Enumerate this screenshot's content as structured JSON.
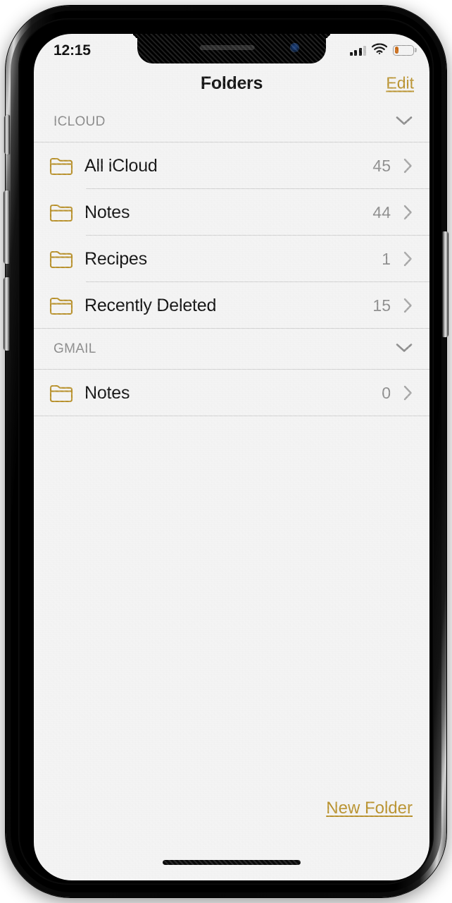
{
  "status_bar": {
    "time": "12:15",
    "cellular_icon": "cellular-bars-icon",
    "wifi_icon": "wifi-icon",
    "battery_icon": "battery-low-icon",
    "battery_level_percent": 22,
    "battery_color": "#c96a16"
  },
  "nav": {
    "title": "Folders",
    "edit_label": "Edit",
    "accent_color": "#b8912c"
  },
  "sections": [
    {
      "title": "ICLOUD",
      "collapse_icon": "chevron-down-icon",
      "rows": [
        {
          "label": "All iCloud",
          "count": "45",
          "icon": "folder-icon",
          "chevron": "chevron-right-icon"
        },
        {
          "label": "Notes",
          "count": "44",
          "icon": "folder-icon",
          "chevron": "chevron-right-icon"
        },
        {
          "label": "Recipes",
          "count": "1",
          "icon": "folder-icon",
          "chevron": "chevron-right-icon"
        },
        {
          "label": "Recently Deleted",
          "count": "15",
          "icon": "folder-icon",
          "chevron": "chevron-right-icon"
        }
      ]
    },
    {
      "title": "GMAIL",
      "collapse_icon": "chevron-down-icon",
      "rows": [
        {
          "label": "Notes",
          "count": "0",
          "icon": "folder-icon",
          "chevron": "chevron-right-icon"
        }
      ]
    }
  ],
  "footer": {
    "new_folder_label": "New Folder"
  },
  "theme": {
    "folder_outline": "#b8912c",
    "separator": "#d2d2d2",
    "screen_background": "#f3f3f3",
    "secondary_text": "#8a8a8a"
  }
}
